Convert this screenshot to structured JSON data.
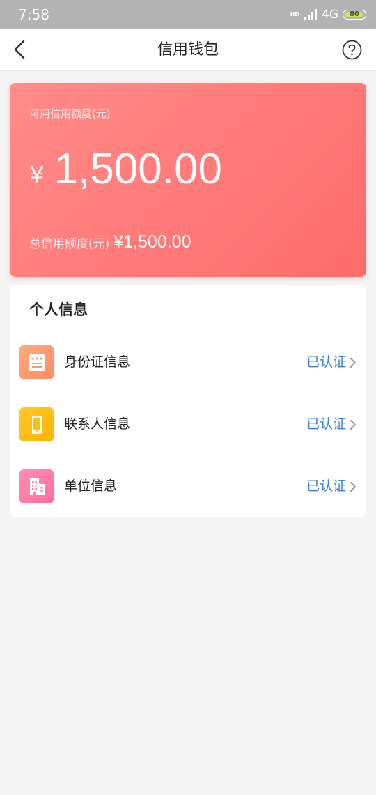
{
  "status_bar": {
    "time": "7:58",
    "hd": "HD",
    "network": "4G",
    "battery": "80",
    "icons": [
      "signal-icon",
      "battery-icon"
    ]
  },
  "nav": {
    "title": "信用钱包",
    "back_icon": "chevron-left-icon",
    "help_icon": "help-circle-icon"
  },
  "credit_card": {
    "available_label": "可用信用额度(元)",
    "currency": "¥",
    "available_amount": "1,500.00",
    "total_label": "总信用额度(元)",
    "total_amount": "¥1,500.00"
  },
  "personal_info": {
    "title": "个人信息",
    "items": [
      {
        "label": "身份证信息",
        "status": "已认证",
        "icon": "id-card-icon",
        "color": "#ff9a6e"
      },
      {
        "label": "联系人信息",
        "status": "已认证",
        "icon": "phone-icon",
        "color": "#ffc107"
      },
      {
        "label": "单位信息",
        "status": "已认证",
        "icon": "building-icon",
        "color": "#ff7eaa"
      }
    ]
  },
  "colors": {
    "card_start": "#ff8c8a",
    "card_end": "#ff6b6b",
    "verified_text": "#3a7fd5",
    "status_bar": "#b3b3b3"
  }
}
